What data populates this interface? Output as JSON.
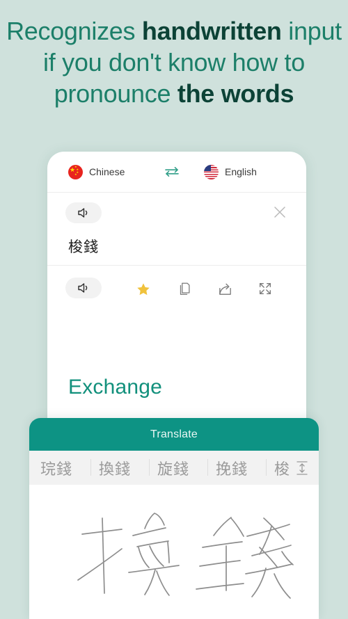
{
  "headline": {
    "lines": [
      [
        {
          "text": "Recognizes ",
          "bold": false
        },
        {
          "text": "handwritten",
          "bold": true
        },
        {
          "text": " input",
          "bold": false
        }
      ],
      [
        {
          "text": "if you don't know how to",
          "bold": false
        }
      ],
      [
        {
          "text": "pronounce ",
          "bold": false
        },
        {
          "text": "the words",
          "bold": true
        }
      ]
    ],
    "line1_regular_a": "Recognizes ",
    "line1_bold": "handwritten",
    "line1_regular_b": " input",
    "line2": "if you don't know how to",
    "line3_regular": "pronounce ",
    "line3_bold": "the words",
    "color_regular": "#1c7f69",
    "color_bold": "#0c4236"
  },
  "app": {
    "language_bar": {
      "source": {
        "label": "Chinese",
        "flag": "flag-china-icon"
      },
      "target": {
        "label": "English",
        "flag": "flag-usa-icon"
      },
      "swap_icon": "swap-arrows-icon"
    },
    "source_panel": {
      "speak_icon": "speaker-icon",
      "clear_icon": "close-x-icon",
      "text": "梭錢"
    },
    "action_row": {
      "speak_icon": "speaker-icon",
      "favorite_icon": "star-icon",
      "copy_icon": "copy-icon",
      "share_icon": "share-icon",
      "expand_icon": "fullscreen-icon",
      "favorite_color": "#f0c23c"
    },
    "result_panel": {
      "text": "Exchange",
      "color": "#12907c"
    }
  },
  "keyboard": {
    "translate_button": "Translate",
    "translate_button_color": "#0d9384",
    "candidates": [
      "琓錢",
      "換錢",
      "旋錢",
      "挽錢",
      "梭"
    ],
    "candidates_expand_icon": "expand-vertical-icon",
    "handwriting_strokes": "換錢"
  },
  "theme": {
    "background": "#cfe1dc",
    "card_background": "#ffffff"
  }
}
